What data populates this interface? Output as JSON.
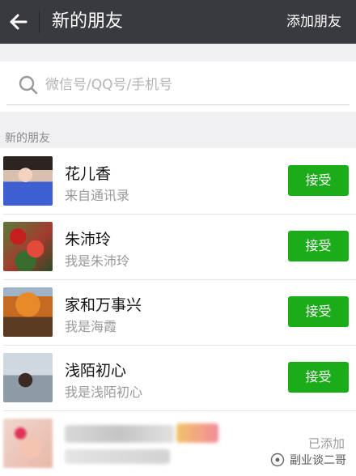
{
  "header": {
    "title": "新的朋友",
    "add_friend": "添加朋友"
  },
  "search": {
    "placeholder": "微信号/QQ号/手机号"
  },
  "section": {
    "label": "新的朋友"
  },
  "requests": [
    {
      "name": "花儿香",
      "sub": "来自通讯录",
      "action": "接受"
    },
    {
      "name": "朱沛玲",
      "sub": "我是朱沛玲",
      "action": "接受"
    },
    {
      "name": "家和万事兴",
      "sub": "我是海霞",
      "action": "接受"
    },
    {
      "name": "浅陌初心",
      "sub": "我是浅陌初心",
      "action": "接受"
    },
    {
      "status": "已添加"
    }
  ],
  "watermark": {
    "text": "副业谈二哥"
  },
  "colors": {
    "header_bg": "#393a3f",
    "accept_green": "#1aad19",
    "page_bg": "#efeff4"
  }
}
